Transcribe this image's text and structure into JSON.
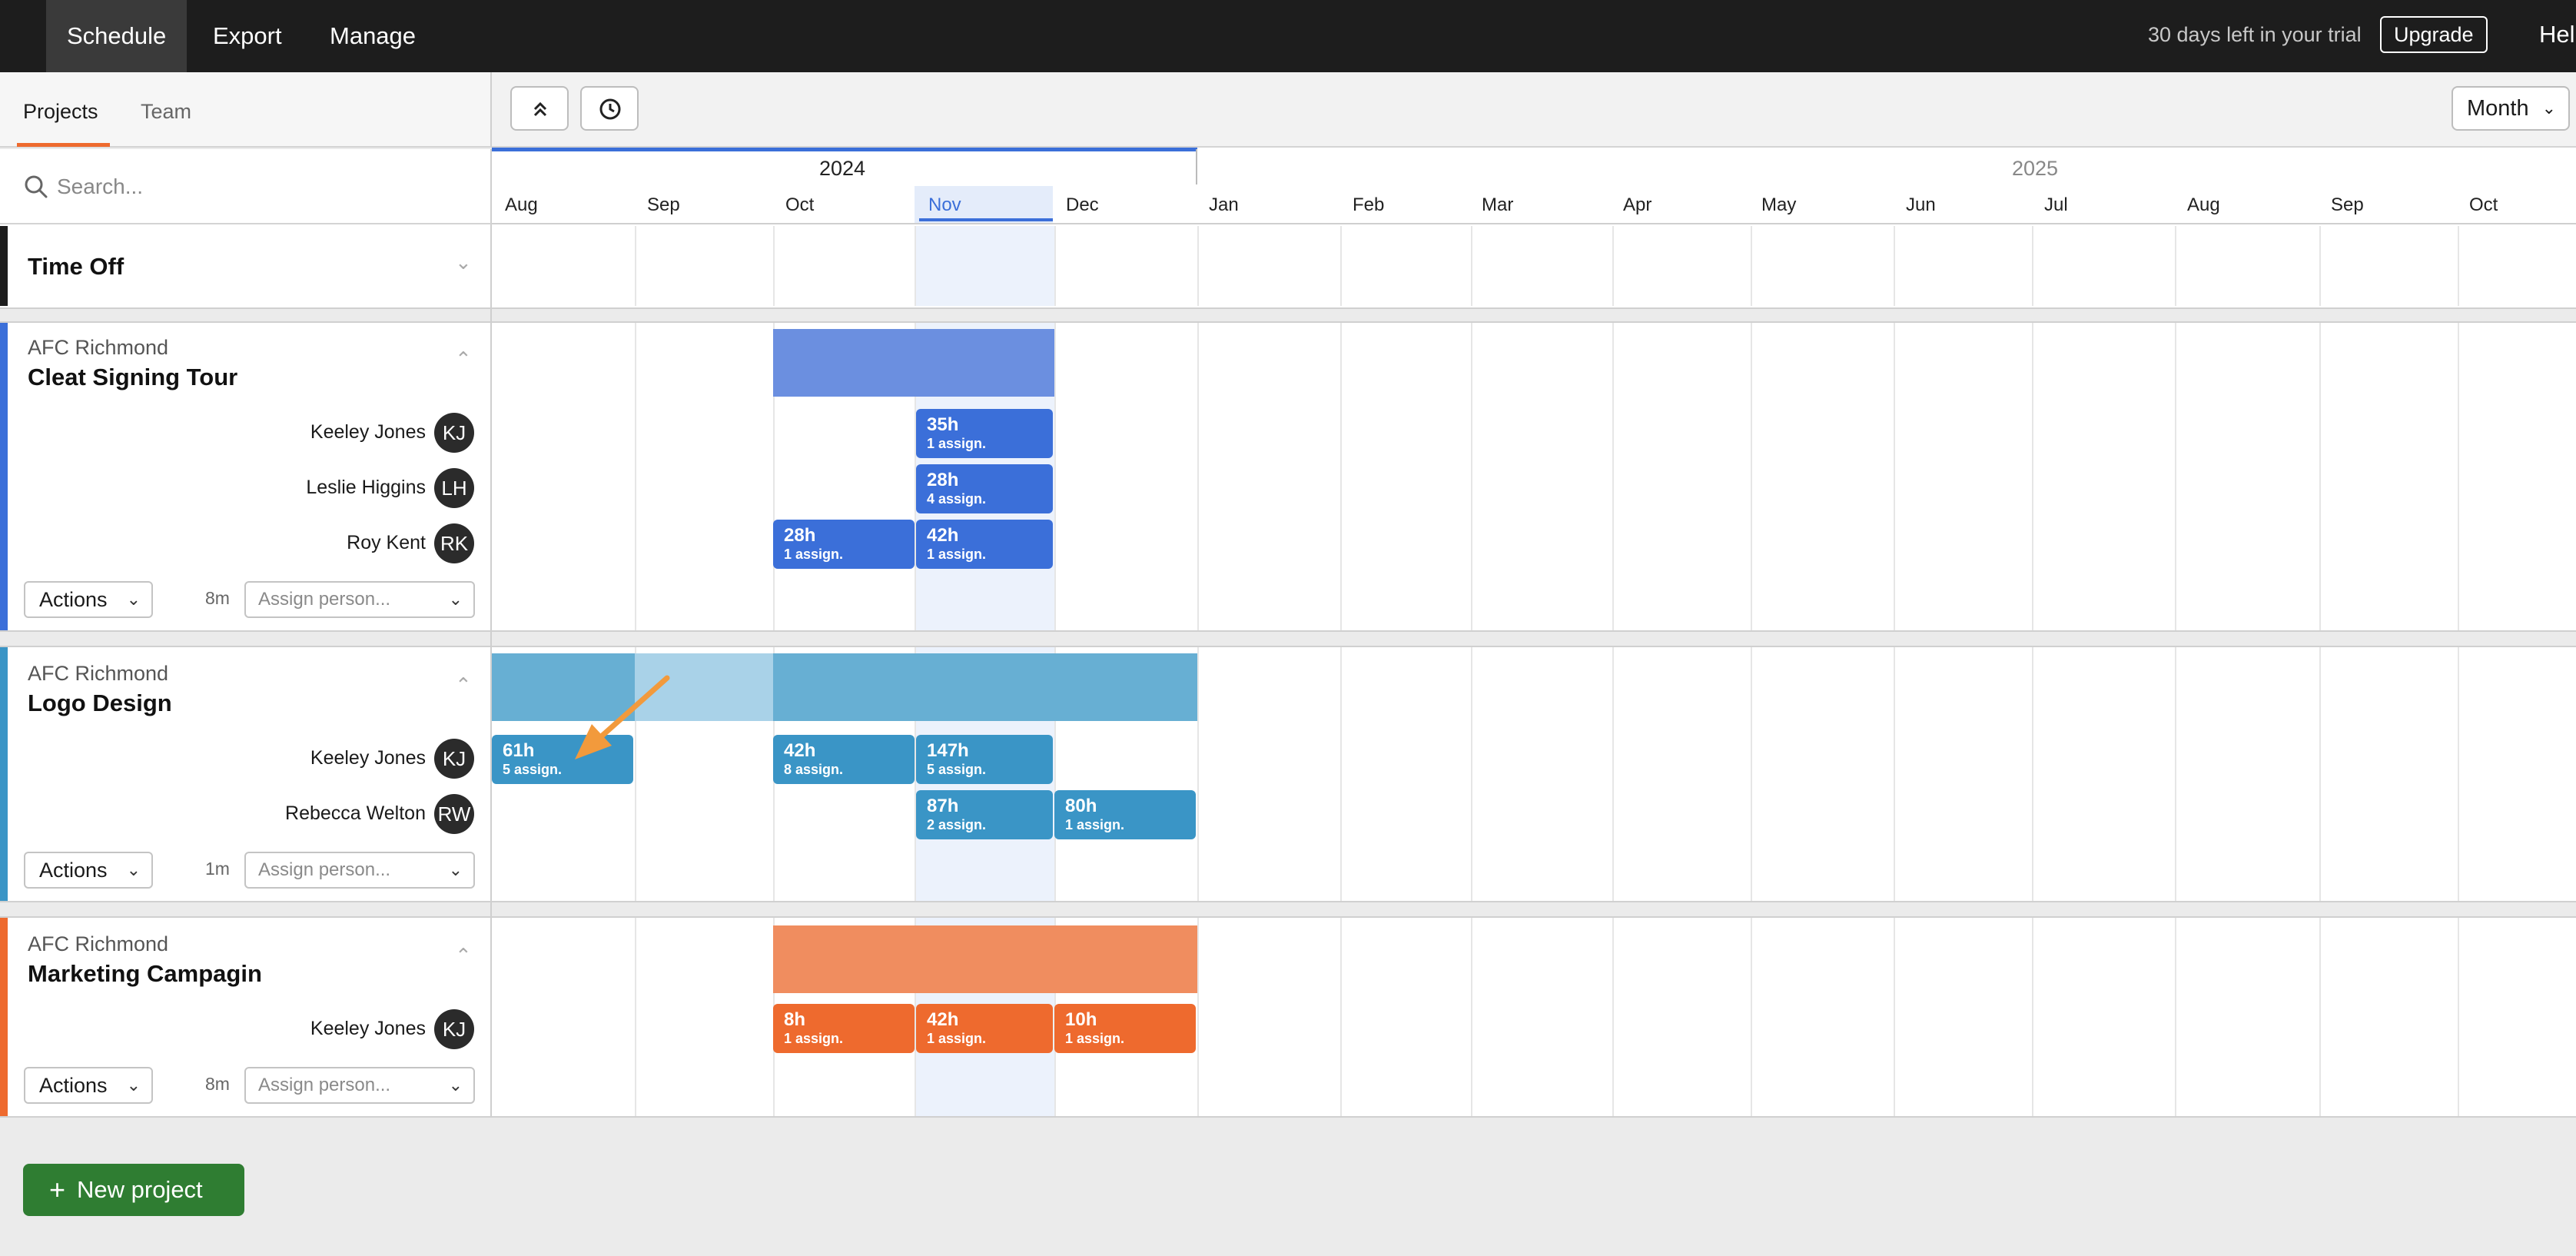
{
  "nav": {
    "tabs": [
      {
        "label": "Schedule",
        "active": true
      },
      {
        "label": "Export",
        "active": false
      },
      {
        "label": "Manage",
        "active": false
      }
    ],
    "trial_text": "30 days left in your trial",
    "upgrade_label": "Upgrade",
    "help_label": "Hel"
  },
  "left": {
    "tabs": [
      "Projects",
      "Team"
    ],
    "active_tab": "Projects",
    "search_placeholder": "Search..."
  },
  "toolbar": {
    "collapse_icon": "chevrons-up-icon",
    "history_icon": "clock-icon",
    "view_select": "Month"
  },
  "timeline": {
    "years": [
      "2024",
      "2025"
    ],
    "months": [
      "Aug",
      "Sep",
      "Oct",
      "Nov",
      "Dec",
      "Jan",
      "Feb",
      "Mar",
      "Apr",
      "May",
      "Jun",
      "Jul",
      "Aug",
      "Sep",
      "Oct"
    ],
    "current_month": "Nov"
  },
  "time_off": {
    "label": "Time Off"
  },
  "projects": [
    {
      "client": "AFC Richmond",
      "name": "Cleat Signing Tour",
      "color": "#3b6fd9",
      "minutes": "8m",
      "actions_label": "Actions",
      "assign_placeholder": "Assign person...",
      "people": [
        {
          "name": "Keeley Jones",
          "initials": "KJ",
          "chips": [
            {
              "month": "Nov",
              "hours": "35h",
              "assign": "1 assign."
            }
          ]
        },
        {
          "name": "Leslie Higgins",
          "initials": "LH",
          "chips": [
            {
              "month": "Nov",
              "hours": "28h",
              "assign": "4 assign."
            }
          ]
        },
        {
          "name": "Roy Kent",
          "initials": "RK",
          "chips": [
            {
              "month": "Oct",
              "hours": "28h",
              "assign": "1 assign."
            },
            {
              "month": "Nov",
              "hours": "42h",
              "assign": "1 assign."
            }
          ]
        }
      ]
    },
    {
      "client": "AFC Richmond",
      "name": "Logo Design",
      "color": "#3a95c6",
      "minutes": "1m",
      "actions_label": "Actions",
      "assign_placeholder": "Assign person...",
      "people": [
        {
          "name": "Keeley Jones",
          "initials": "KJ",
          "chips": [
            {
              "month": "Aug",
              "hours": "61h",
              "assign": "5 assign."
            },
            {
              "month": "Oct",
              "hours": "42h",
              "assign": "8 assign."
            },
            {
              "month": "Nov",
              "hours": "147h",
              "assign": "5 assign."
            }
          ]
        },
        {
          "name": "Rebecca Welton",
          "initials": "RW",
          "chips": [
            {
              "month": "Nov",
              "hours": "87h",
              "assign": "2 assign."
            },
            {
              "month": "Dec",
              "hours": "80h",
              "assign": "1 assign."
            }
          ]
        }
      ]
    },
    {
      "client": "AFC Richmond",
      "name": "Marketing Campagin",
      "color": "#ee6a2e",
      "minutes": "8m",
      "actions_label": "Actions",
      "assign_placeholder": "Assign person...",
      "people": [
        {
          "name": "Keeley Jones",
          "initials": "KJ",
          "chips": [
            {
              "month": "Oct",
              "hours": "8h",
              "assign": "1 assign."
            },
            {
              "month": "Nov",
              "hours": "42h",
              "assign": "1 assign."
            },
            {
              "month": "Dec",
              "hours": "10h",
              "assign": "1 assign."
            }
          ]
        }
      ]
    }
  ],
  "new_project_label": "New project",
  "colors": {
    "cleat": "#3b6fd9",
    "logo": "#3a95c6",
    "marketing": "#ee6a2e",
    "accent_orange": "#ee6a2e",
    "new_project_green": "#2f7d32"
  }
}
